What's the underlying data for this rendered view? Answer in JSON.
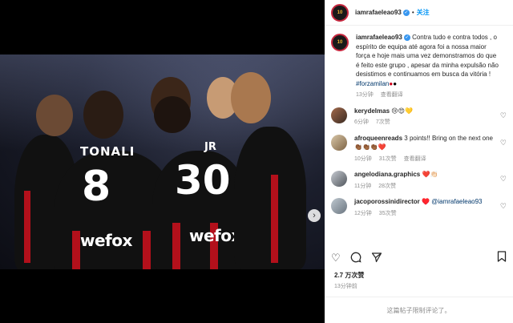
{
  "post": {
    "username": "iamrafaeleao93",
    "separator": "•",
    "follow_label": "关注",
    "avatar_text": "10",
    "caption_text": "Contra tudo e contra todos , o espírito de equipa até agora foi a nossa maior força e hoje mais uma vez demonstramos do que é feito este grupo , apesar da minha expulsão não desistimos e continuamos em busca da vitória !",
    "hashtag": "#forzamilan",
    "caption_time": "13分钟",
    "caption_translate": "查看翻译",
    "likes": "2.7 万次赞",
    "post_time": "13分钟前",
    "comments_limited": "这篇帖子限制评论了。"
  },
  "photo": {
    "jersey_name": "TONALI",
    "number_left": "8",
    "number_right": "30",
    "jr_text": "JR",
    "sponsor": "wefox"
  },
  "comments": [
    {
      "user": "kerydelmas",
      "text": "😢😍💛",
      "time": "6分钟",
      "likes": "7次赞",
      "translate": ""
    },
    {
      "user": "afroqueenreads",
      "text": "3 points!! Bring on the next one👏🏾👏🏾👏🏾❤️",
      "time": "10分钟",
      "likes": "31次赞",
      "translate": "查看翻译"
    },
    {
      "user": "angelodiana.graphics",
      "text": "❤️👏🏻",
      "time": "11分钟",
      "likes": "28次赞",
      "translate": ""
    },
    {
      "user": "jacoporossinidirector",
      "text": "♥️",
      "mention": "@iamrafaeleao93",
      "time": "12分钟",
      "likes": "35次赞",
      "translate": ""
    }
  ],
  "colors": {
    "accent": "#0095f6",
    "milan_red": "#b3101b",
    "meta_gray": "#8e8e8e"
  },
  "icons": [
    "heart-icon",
    "comment-icon",
    "share-icon",
    "bookmark-icon",
    "chevron-right-icon",
    "verified-icon"
  ]
}
